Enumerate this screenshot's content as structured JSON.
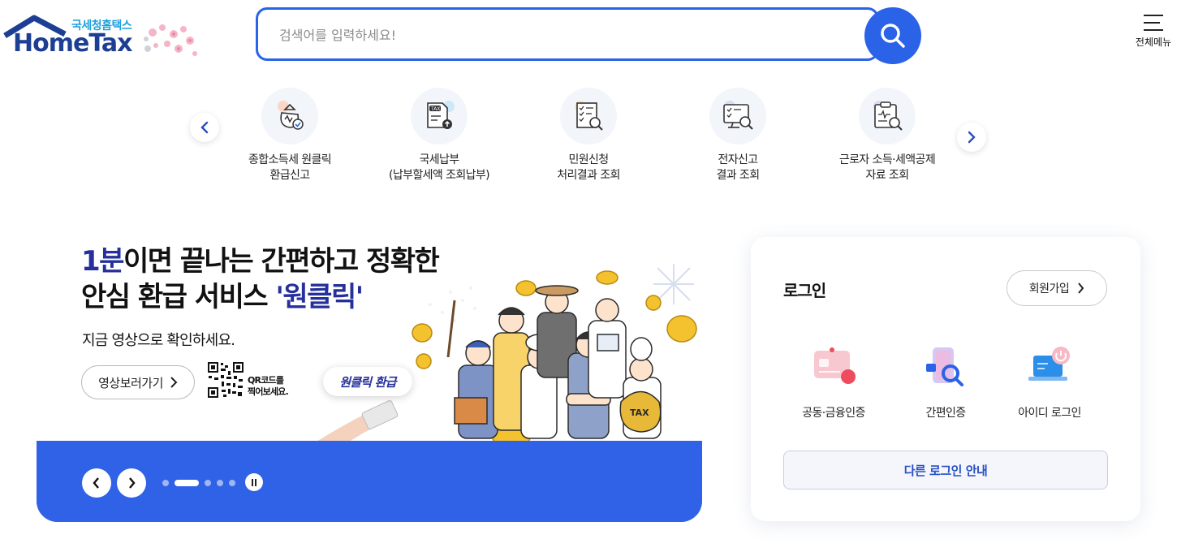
{
  "header": {
    "logo_kr": "국세청홈택스",
    "logo_en": "HomeTax",
    "search_placeholder": "검색어를 입력하세요!",
    "search_value": "",
    "all_menu_label": "전체메뉴"
  },
  "quick_menu": {
    "items": [
      {
        "line1": "종합소득세 원클릭",
        "line2": "환급신고",
        "icon": "money-bag-check-icon"
      },
      {
        "line1": "국세납부",
        "line2": "(납부할세액 조회납부)",
        "icon": "tax-document-upload-icon"
      },
      {
        "line1": "민원신청",
        "line2": "처리결과 조회",
        "icon": "checklist-search-icon"
      },
      {
        "line1": "전자신고",
        "line2": "결과 조회",
        "icon": "monitor-search-icon"
      },
      {
        "line1": "근로자 소득·세액공제",
        "line2": "자료 조회",
        "icon": "clipboard-search-icon"
      }
    ]
  },
  "banner": {
    "headline_accent": "1분",
    "headline_rest1": "이면 끝나는 간편하고 정확한",
    "headline_line2a": "안심 환급 서비스 ",
    "headline_line2b": "'원클릭'",
    "subtitle": "지금 영상으로 확인하세요.",
    "video_button": "영상보러가기",
    "qr_line1": "QR코드를",
    "qr_line2": "찍어보세요.",
    "badge_text": "원클릭 환급",
    "slide_count": 5,
    "active_slide": 1
  },
  "login": {
    "title": "로그인",
    "join_button": "회원가입",
    "options": [
      {
        "label": "공동·금융인증",
        "icon": "certificate-card-icon"
      },
      {
        "label": "간편인증",
        "icon": "phone-search-icon"
      },
      {
        "label": "아이디 로그인",
        "icon": "laptop-power-icon"
      }
    ],
    "other_button": "다른 로그인 안내"
  },
  "colors": {
    "primary": "#2a62e8",
    "banner_bar": "#2f62e6",
    "accent_text": "#26309a",
    "logo_blue": "#1c3f94",
    "logo_cyan": "#1fa0dc"
  }
}
